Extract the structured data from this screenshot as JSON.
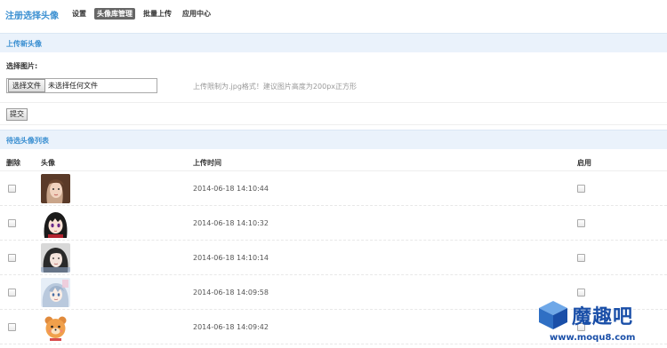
{
  "app": {
    "title": "注册选择头像"
  },
  "nav": [
    {
      "label": "设置",
      "active": false
    },
    {
      "label": "头像库管理",
      "active": true
    },
    {
      "label": "批量上传",
      "active": false
    },
    {
      "label": "应用中心",
      "active": false
    }
  ],
  "upload_section": {
    "title": "上传新头像",
    "select_label": "选择图片:",
    "file_button": "选择文件",
    "file_status": "未选择任何文件",
    "hint": "上传限制为.jpg格式！建议图片高度为200px正方形",
    "submit": "提交"
  },
  "list_section": {
    "title": "待选头像列表",
    "headers": {
      "delete": "删除",
      "avatar": "头像",
      "upload_time": "上传时间",
      "enable": "启用"
    }
  },
  "rows": [
    {
      "time": "2014-06-18 14:10:44",
      "avatar": "avatar-girl-brown-hair"
    },
    {
      "time": "2014-06-18 14:10:32",
      "avatar": "avatar-anime-girl-black-hair"
    },
    {
      "time": "2014-06-18 14:10:14",
      "avatar": "avatar-girl-pale"
    },
    {
      "time": "2014-06-18 14:09:58",
      "avatar": "avatar-anime-blue"
    },
    {
      "time": "2014-06-18 14:09:42",
      "avatar": "avatar-cartoon-bear"
    }
  ],
  "watermark": {
    "text": "魔趣吧",
    "url": "www.moqu8.com"
  },
  "colors": {
    "accent": "#3a8fd1",
    "section_bg": "#eaf2fb",
    "active_nav": "#666666",
    "watermark": "#1a4fa8"
  }
}
